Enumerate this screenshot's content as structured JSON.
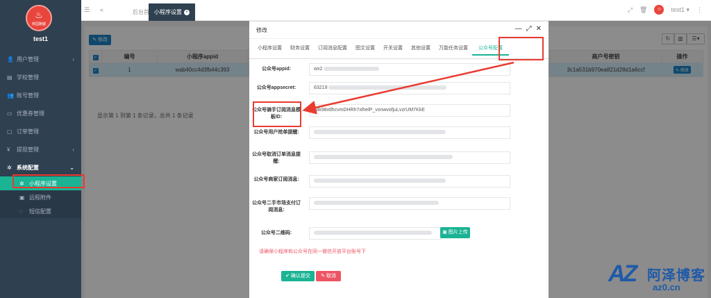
{
  "sidebar": {
    "logo_text": "校园跑腿",
    "username": "test1",
    "menu": [
      {
        "label": "用户管理",
        "has_arrow": true
      },
      {
        "label": "学校管理"
      },
      {
        "label": "账号管理"
      },
      {
        "label": "优惠券管理"
      },
      {
        "label": "订单管理"
      },
      {
        "label": "提现管理",
        "has_arrow": true
      },
      {
        "label": "系统配置",
        "has_arrow": true
      }
    ],
    "submenu": [
      {
        "label": "小程序设置"
      },
      {
        "label": "远程附件"
      },
      {
        "label": "短信配置"
      }
    ]
  },
  "topbar": {
    "home_tab": "后台首页",
    "current_tab": "小程序设置",
    "user": "test1"
  },
  "panel": {
    "edit_button": "修改",
    "columns": [
      "编号",
      "小程序appid",
      "商户号密钥",
      "操作"
    ],
    "row": {
      "id": "1",
      "appid": "wab40cc4d3fb44c393",
      "mch_key": "3c1a531b970ea821d28d1a6ccf",
      "action": "修改"
    },
    "footer": "显示第 1 到第 1 条记录，总共 1 条记录"
  },
  "modal": {
    "title": "修改",
    "tabs": [
      "小程序设置",
      "财务设置",
      "订阅消息配置",
      "图文设置",
      "开关设置",
      "其他设置",
      "万能任务设置",
      "公众号配置"
    ],
    "active_tab": "公众号配置",
    "fields": [
      {
        "label": "公众号appid:",
        "value": "wx2"
      },
      {
        "label": "公众号appsecret:",
        "value": "63219"
      },
      {
        "label": "公众号骑手订阅消息模板ID:",
        "value": "zdk98xtlhcvmDHRh7xlhelP_vxnwvofjuLvzrUM7KkE"
      },
      {
        "label": "公众号用户抢单提醒:",
        "value": ""
      },
      {
        "label": "公众号取消订单消息提醒:",
        "value": ""
      },
      {
        "label": "公众号商家订阅消息:",
        "value": ""
      },
      {
        "label": "公众号二手市场支付订阅消息:",
        "value": ""
      },
      {
        "label": "公众号二维码:",
        "value": ""
      }
    ],
    "upload_button": "图片上传",
    "notice": "请确保小程序和公众号在同一微信开放平台账号下",
    "confirm_button": "确认提交",
    "cancel_button": "取消"
  },
  "watermark": {
    "logo": "AZ",
    "name": "阿泽博客",
    "domain": "az0.cn"
  },
  "colors": {
    "sidebar": "#2f4050",
    "accent": "#1ab394",
    "primary": "#1c84c6",
    "danger": "#ed5565",
    "annotation": "#e93b30"
  }
}
